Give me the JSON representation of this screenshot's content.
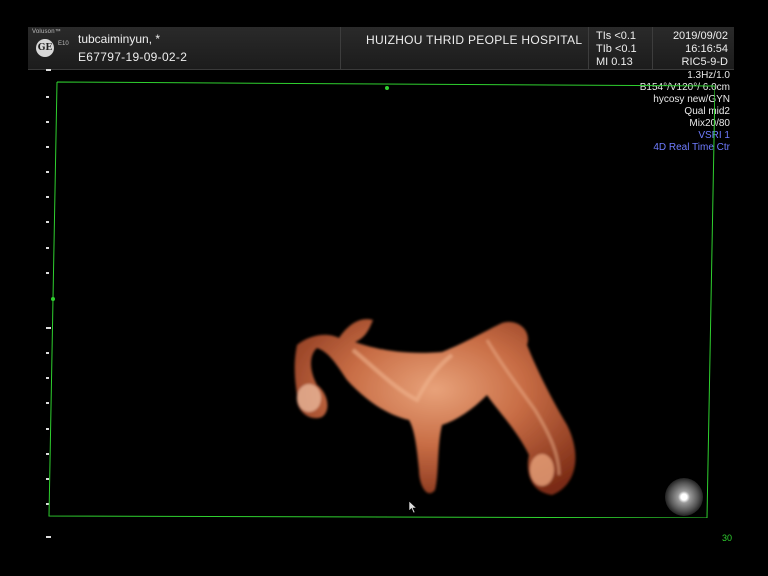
{
  "header": {
    "brand": "Voluson™",
    "model": "E10",
    "logo_text": "GE",
    "patient_name": "tubcaiminyun,  *",
    "patient_id": "E67797-19-09-02-2",
    "hospital": "HUIZHOU THRID PEOPLE HOSPITAL",
    "tis": "TIs <0.1",
    "tib": "TIb <0.1",
    "mi": "MI 0.13",
    "date": "2019/09/02",
    "time": "16:16:54",
    "probe": "RIC5-9-D"
  },
  "parameters": {
    "frame_rate": "1.3Hz/1.0",
    "volume": "B154°/V120°/ 6.0cm",
    "program": "hycosy new/GYN",
    "quality": "Qual mid2",
    "mix": "Mix20/80",
    "vsri": "VSRI 1",
    "mode": "4D Real Time Ctr"
  },
  "depth_label": "30",
  "colors": {
    "frame_green": "#2fd02f",
    "mode_blue": "#6f7cff",
    "render_orange": "#d9875a"
  },
  "icons": {
    "orientation": "orientation-sphere-icon",
    "cursor": "mouse-pointer-icon"
  }
}
